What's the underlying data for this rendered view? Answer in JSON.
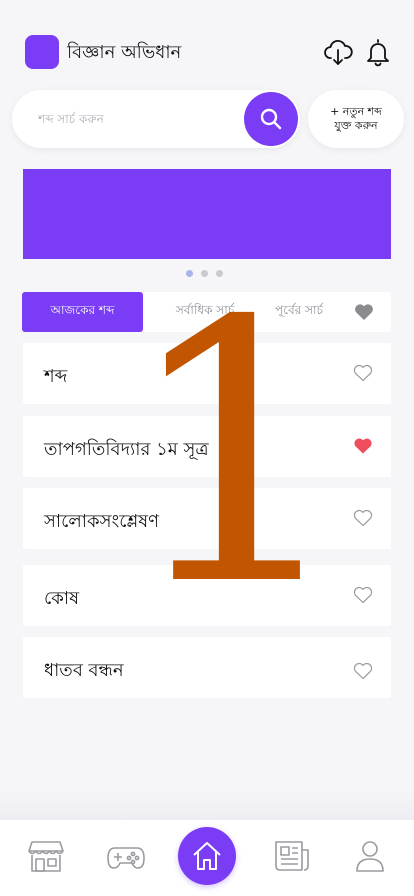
{
  "header": {
    "app_title": "বিজ্ঞান অভিধান",
    "icons": [
      "cloud-download-icon",
      "bell-icon"
    ]
  },
  "search": {
    "placeholder": "শব্দ সার্চ করুন",
    "value": ""
  },
  "add_word": {
    "line1": "+ নতুন শব্দ",
    "line2": "যুক্ত করুন"
  },
  "banner": {
    "color": "#7a3cf5",
    "slides": 3,
    "active_slide": 1
  },
  "tabs": [
    {
      "label": "আজকের শব্দ",
      "active": true
    },
    {
      "label": "সর্বাধিক সার্চ",
      "active": false
    },
    {
      "label": "পূর্বের সার্চ",
      "active": false
    }
  ],
  "words": [
    {
      "text": "শব্দ",
      "favorite": false
    },
    {
      "text": "তাপগতিবিদ্যার ১ম সূত্র",
      "favorite": true
    },
    {
      "text": "সালোকসংশ্লেষণ",
      "favorite": false
    },
    {
      "text": "কোষ",
      "favorite": false
    },
    {
      "text": "ধাতব বন্ধন",
      "favorite": false
    }
  ],
  "overlay_number": "1",
  "bottom_nav": [
    "store-icon",
    "gamepad-icon",
    "home-icon",
    "newspaper-icon",
    "user-icon"
  ],
  "colors": {
    "accent": "#7a3cf5",
    "favorite": "#f04e5e",
    "overlay": "#c25500"
  }
}
